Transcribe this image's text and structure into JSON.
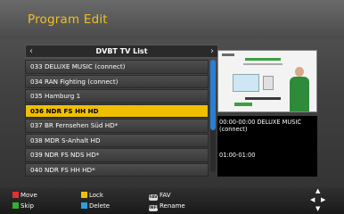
{
  "header": {
    "title": "Program Edit"
  },
  "list": {
    "title": "DVBT TV List",
    "nav_left": "‹",
    "nav_right": "›",
    "rows": [
      "033 DELUXE MUSIC (connect)",
      "034 RAN Fighting (connect)",
      "035 Hamburg 1",
      "036 NDR FS HH HD",
      "037 BR Fernsehen Süd HD*",
      "038 MDR S-Anhalt HD",
      "039 NDR FS NDS HD*",
      "040 NDR FS HH HD*"
    ],
    "selected_index": 3,
    "scroll_fraction": 0.63
  },
  "epg": {
    "current": "00:00-00:00  DELUXE MUSIC (connect)",
    "next": "01:00-01:00"
  },
  "footer": {
    "move": "Move",
    "skip": "Skip",
    "lock": "Lock",
    "delete": "Delete",
    "fav": "FAV",
    "rename": "Rename",
    "fav_key": "FAV",
    "rename_key": "INFO"
  },
  "colors": {
    "title": "#f0c020",
    "selected_row": "#f0c000",
    "scroll_thumb": "#2a7fd4",
    "key_red": "#e53030",
    "key_green": "#30b030",
    "key_yellow": "#f0c000",
    "key_blue": "#2aa0e0"
  },
  "icons": {
    "nav": "dpad-arrows-icon",
    "fav_key": "fav-key-icon",
    "rename_key": "info-key-icon"
  }
}
